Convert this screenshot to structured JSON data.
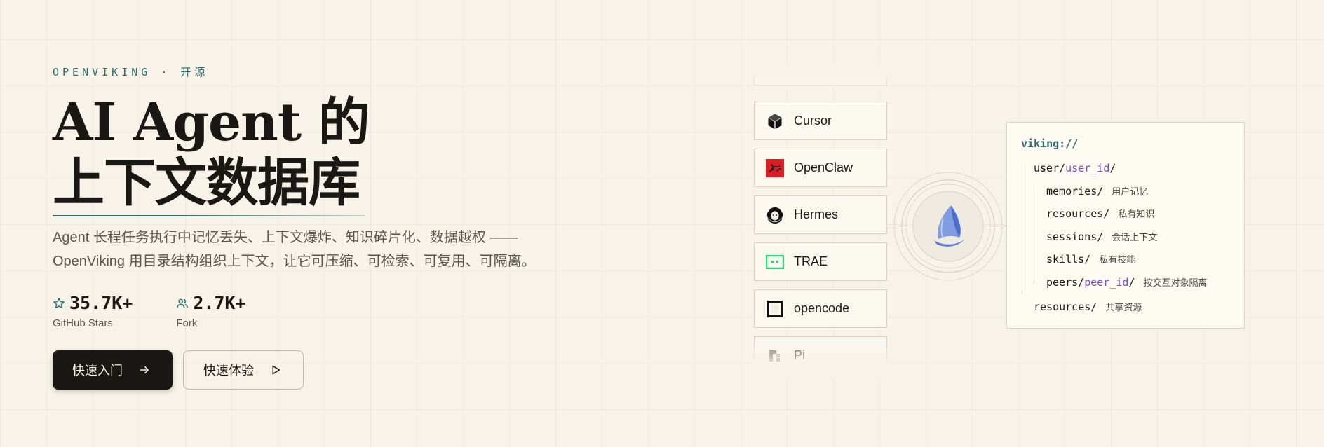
{
  "hero": {
    "eyebrow": "OPENVIKING · 开源",
    "title_line1": "AI Agent 的",
    "title_line2": "上下文数据库",
    "desc_line1": "Agent 长程任务执行中记忆丢失、上下文爆炸、知识碎片化、数据越权 ——",
    "desc_line2": "OpenViking 用目录结构组织上下文，让它可压缩、可检索、可复用、可隔离。"
  },
  "stats": {
    "stars": {
      "value": "35.7K+",
      "label": "GitHub Stars",
      "icon": "star-icon"
    },
    "forks": {
      "value": "2.7K+",
      "label": "Fork",
      "icon": "users-icon"
    }
  },
  "buttons": {
    "primary": {
      "label": "快速入门",
      "icon": "arrow-right-icon"
    },
    "secondary": {
      "label": "快速体验",
      "icon": "play-icon"
    }
  },
  "agents": [
    {
      "name": "",
      "icon": "partial-icon"
    },
    {
      "name": "Cursor",
      "icon": "cursor-cube-icon"
    },
    {
      "name": "OpenClaw",
      "icon": "openclaw-icon"
    },
    {
      "name": "Hermes",
      "icon": "hermes-icon"
    },
    {
      "name": "TRAE",
      "icon": "trae-icon"
    },
    {
      "name": "opencode",
      "icon": "opencode-icon"
    },
    {
      "name": "Pi",
      "icon": "pi-icon"
    }
  ],
  "hub": {
    "icon": "viking-sail-icon"
  },
  "tree": {
    "root": "viking://",
    "user_prefix": "user/",
    "user_var": "user_id",
    "user_suffix": "/",
    "items": [
      {
        "path": "memories/",
        "note": "用户记忆"
      },
      {
        "path": "resources/",
        "note": "私有知识"
      },
      {
        "path": "sessions/",
        "note": "会话上下文"
      },
      {
        "path": "skills/",
        "note": "私有技能"
      }
    ],
    "peers_prefix": "peers/",
    "peers_var": "peer_id",
    "peers_suffix": "/",
    "peers_note": "按交互对象隔离",
    "shared_path": "resources/",
    "shared_note": "共享资源"
  },
  "colors": {
    "background": "#f7f3e8",
    "accent_teal": "#2f6e6e",
    "ink": "#1a1814",
    "purple": "#7b4fc9"
  }
}
